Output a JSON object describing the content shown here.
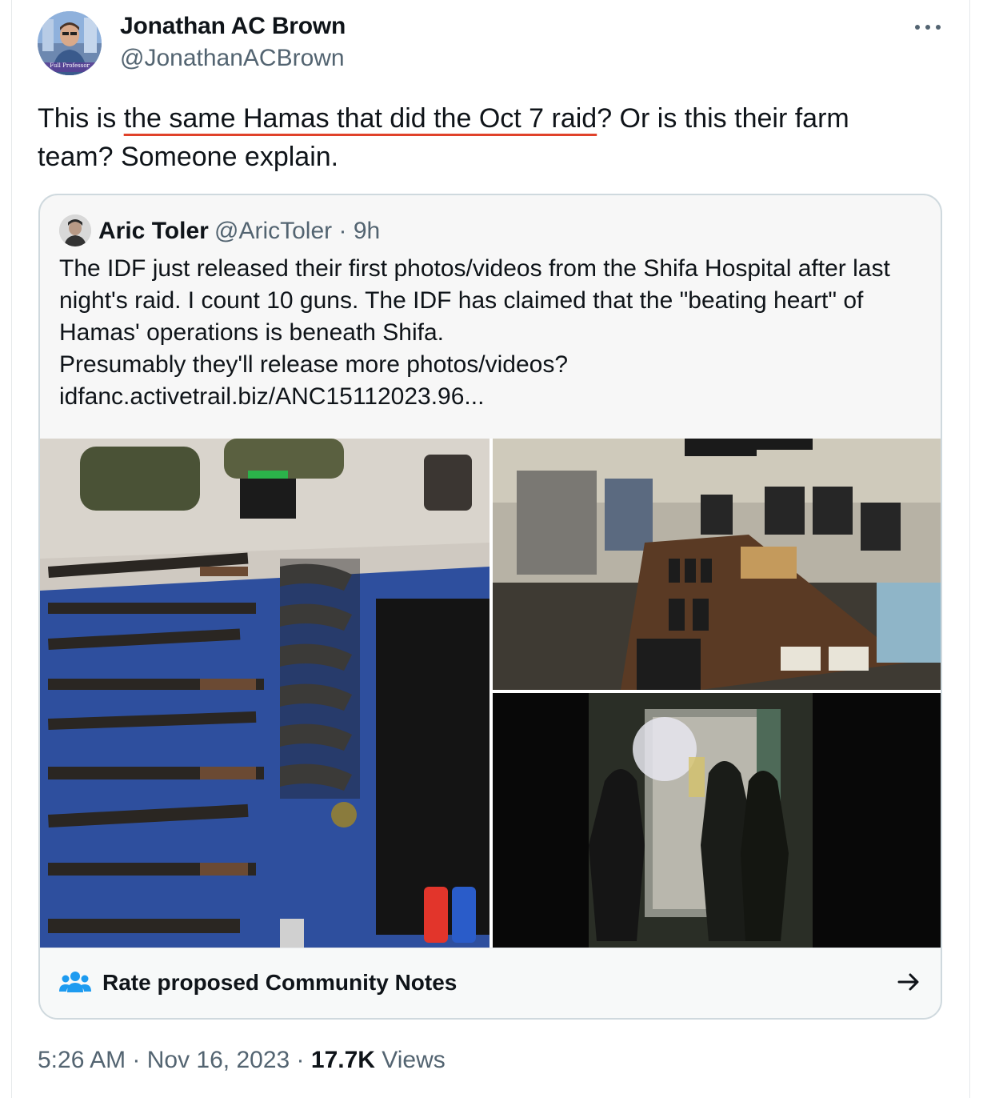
{
  "tweet": {
    "author_name": "Jonathan AC Brown",
    "author_handle": "@JonathanACBrown",
    "avatar_badge": "Full Professor",
    "more_icon": "ellipsis-icon",
    "text_before": "This is ",
    "text_highlight": "the same Hamas that did the Oct 7 raid",
    "text_after": "? Or is this their farm team? Someone explain."
  },
  "quote": {
    "author_name": "Aric Toler",
    "author_handle": "@AricToler",
    "time": "9h",
    "lines": [
      "The IDF just released their first photos/videos from the Shifa Hospital after last",
      "night's raid. I count 10 guns. The IDF has claimed that the \"beating heart\" of",
      "Hamas' operations is beneath Shifa.",
      "Presumably they'll release more photos/videos?",
      "idfanc.activetrail.biz/ANC15112023.96..."
    ]
  },
  "community_notes": {
    "label": "Rate proposed Community Notes",
    "icon": "people-icon",
    "arrow_icon": "arrow-right-icon",
    "accent_color": "#1d9bf0"
  },
  "footer": {
    "time": "5:26 AM",
    "date": "Nov 16, 2023",
    "views_count": "17.7K",
    "views_label": "Views"
  },
  "colors": {
    "underline": "#e0422a",
    "secondary_text": "#536471",
    "border": "#cfd9de"
  }
}
